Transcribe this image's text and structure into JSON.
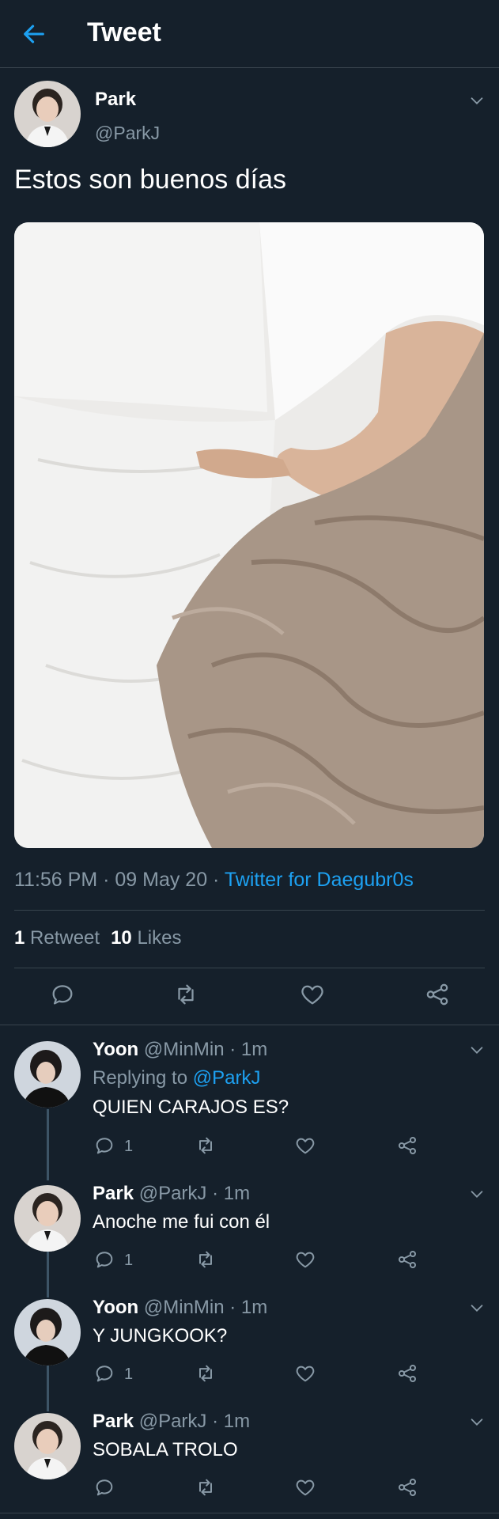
{
  "header": {
    "title": "Tweet"
  },
  "tweet": {
    "name": "Park",
    "handle": "@ParkJ",
    "text": "Estos son buenos días",
    "meta_prefix": "11:56 PM · 09 May 20 · ",
    "meta_source": "Twitter for Daegubr0s",
    "retweets_count": "1",
    "retweets_label": "Retweet",
    "likes_count": "10",
    "likes_label": "Likes"
  },
  "replies": [
    {
      "name": "Yoon",
      "meta": " @MinMin · 1m",
      "replying_prefix": "Replying to ",
      "replying_to": "@ParkJ",
      "text": "QUIEN CARAJOS ES?",
      "reply_count": "1"
    },
    {
      "name": "Park",
      "meta": " @ParkJ · 1m",
      "text": "Anoche me fui con él",
      "reply_count": "1"
    },
    {
      "name": "Yoon",
      "meta": " @MinMin · 1m",
      "text": "Y JUNGKOOK?",
      "reply_count": "1"
    },
    {
      "name": "Park",
      "meta": " @ParkJ · 1m",
      "text": "SOBALA TROLO",
      "reply_count": ""
    }
  ],
  "colors": {
    "background": "#15202b",
    "accent": "#1da1f2",
    "muted": "#8899a6",
    "divider": "#38444d"
  }
}
